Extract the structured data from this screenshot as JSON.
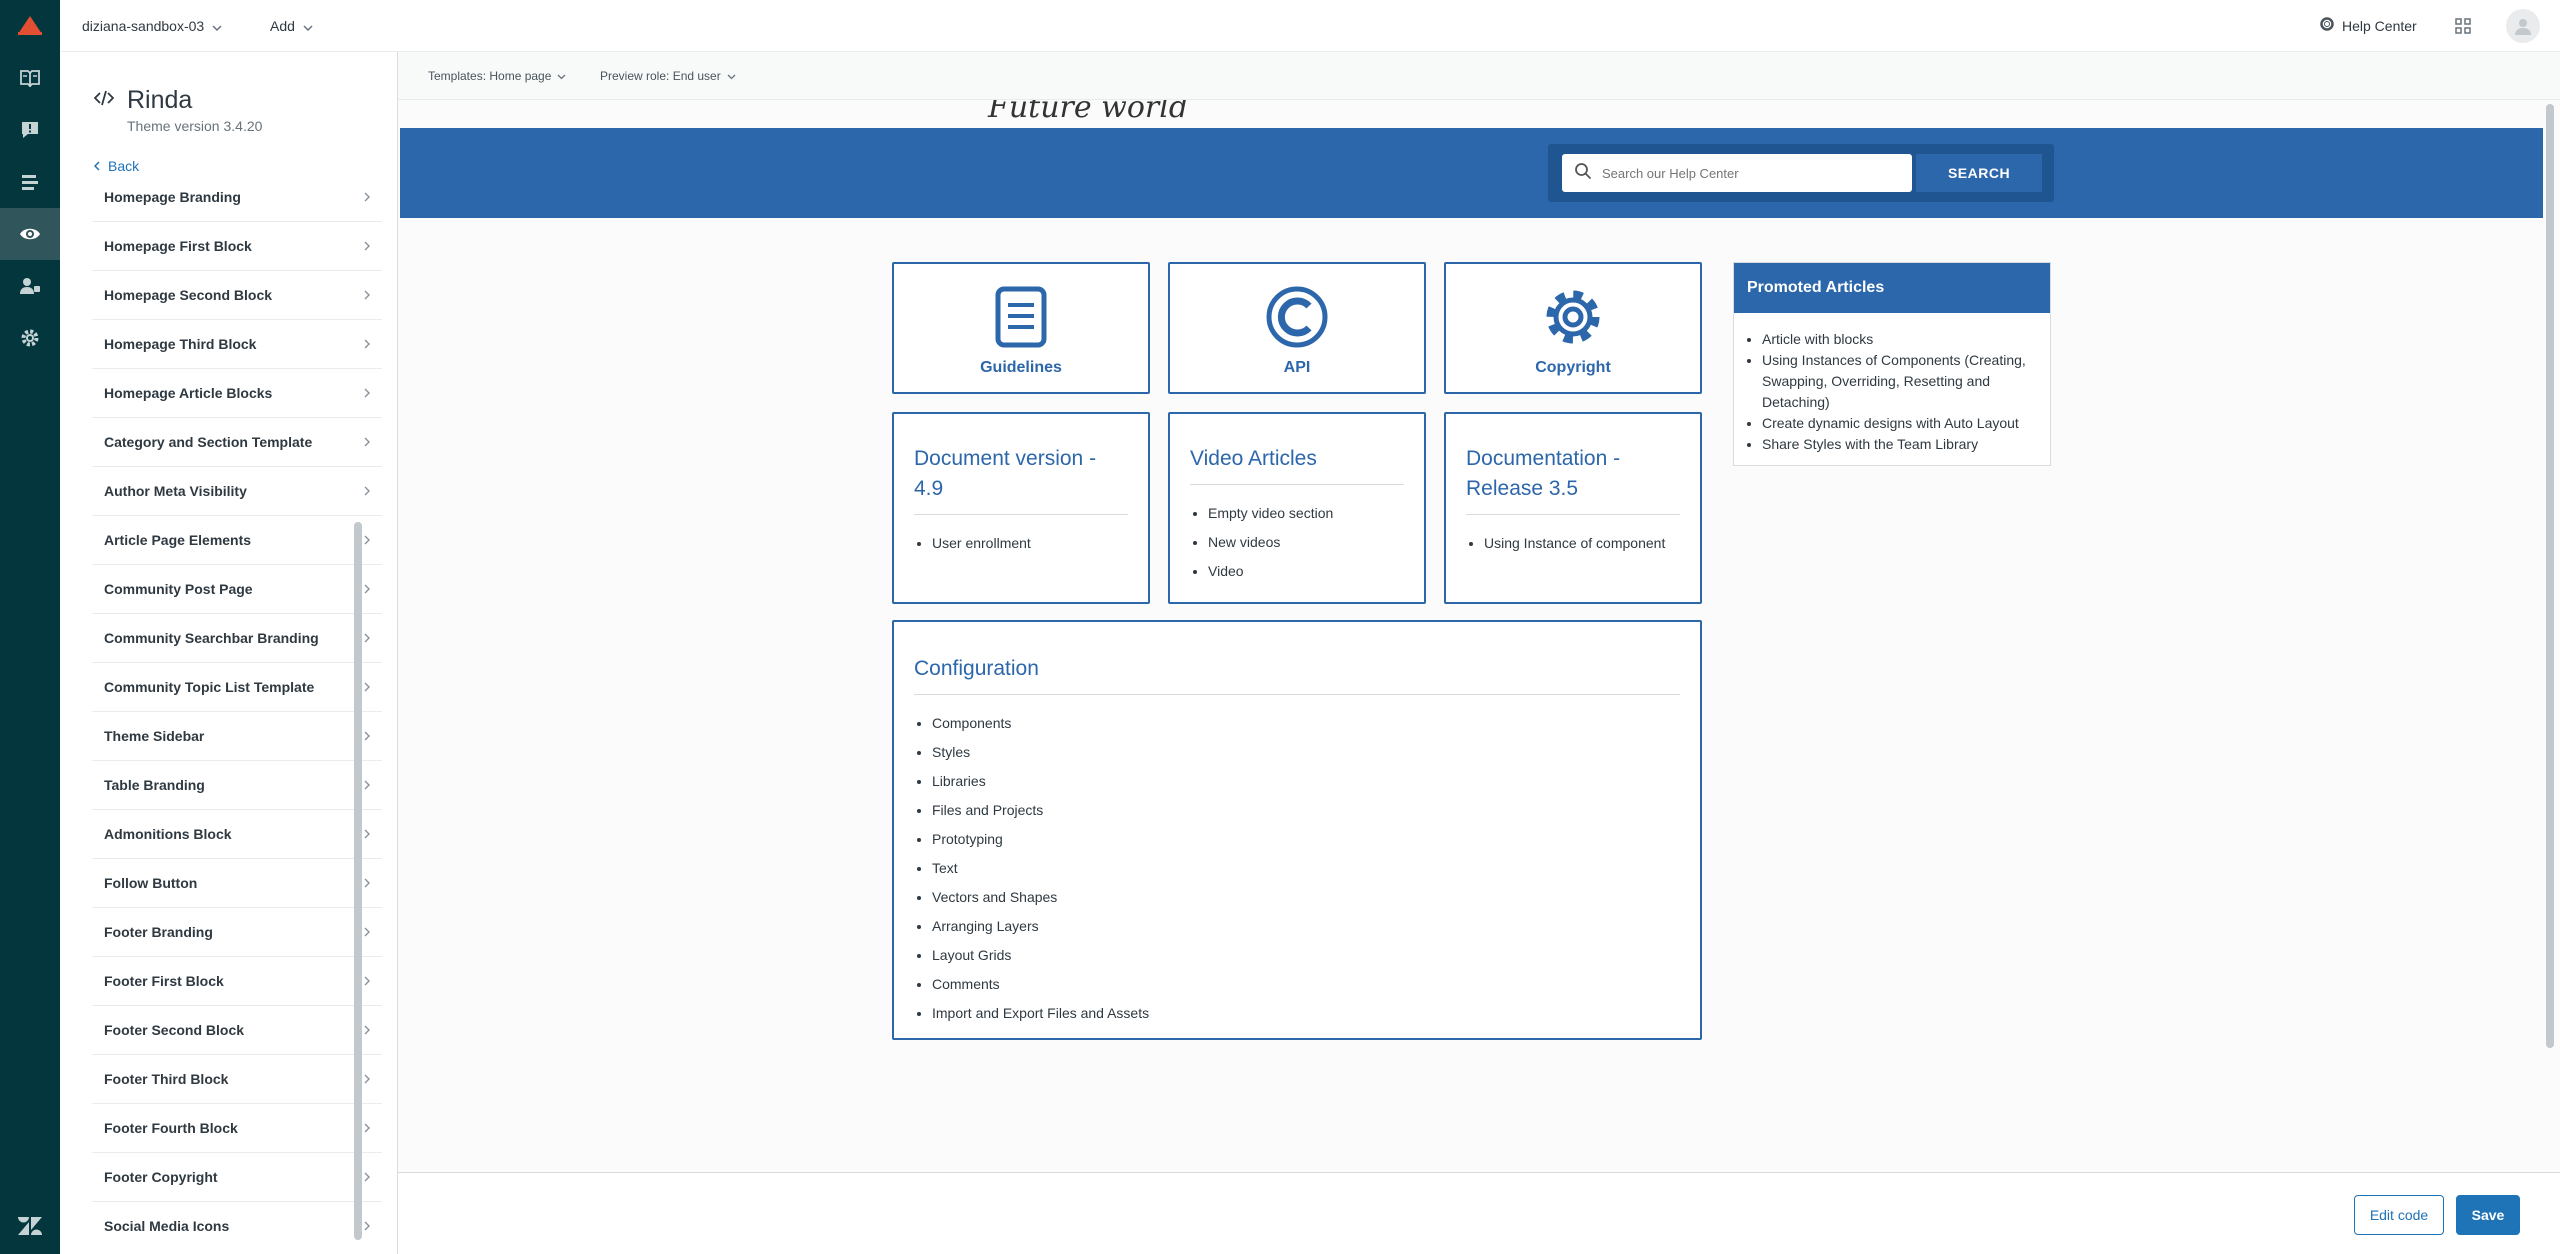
{
  "header": {
    "account": "diziana-sandbox-03",
    "add_label": "Add",
    "help_center": "Help Center"
  },
  "nav": {
    "icons": [
      "guide-icon",
      "feedback-icon",
      "arrange-icon",
      "customize-design-icon",
      "user-permissions-icon",
      "settings-icon"
    ],
    "active_index": 3
  },
  "panel": {
    "theme_name": "Rinda",
    "theme_version": "Theme version 3.4.20",
    "back_label": "Back",
    "items": [
      "Homepage Branding",
      "Homepage First Block",
      "Homepage Second Block",
      "Homepage Third Block",
      "Homepage Article Blocks",
      "Category and Section Template",
      "Author Meta Visibility",
      "Article Page Elements",
      "Community Post Page",
      "Community Searchbar Branding",
      "Community Topic List Template",
      "Theme Sidebar",
      "Table Branding",
      "Admonitions Block",
      "Follow Button",
      "Footer Branding",
      "Footer First Block",
      "Footer Second Block",
      "Footer Third Block",
      "Footer Fourth Block",
      "Footer Copyright",
      "Social Media Icons"
    ]
  },
  "preview": {
    "template_label": "Templates: Home page",
    "role_label": "Preview role: End user",
    "site_logo_text": "Future world",
    "search_placeholder": "Search our Help Center",
    "search_button": "SEARCH",
    "icon_cards": [
      {
        "label": "Guidelines",
        "icon": "document-icon"
      },
      {
        "label": "API",
        "icon": "copyright-circle-icon"
      },
      {
        "label": "Copyright",
        "icon": "gear-icon"
      }
    ],
    "sections": [
      {
        "title": "Document version - 4.9",
        "items": [
          "User enrollment"
        ]
      },
      {
        "title": "Video Articles",
        "items": [
          "Empty video section",
          "New videos",
          "Video"
        ]
      },
      {
        "title": "Documentation - Release 3.5",
        "items": [
          "Using Instance of component"
        ]
      }
    ],
    "configuration": {
      "title": "Configuration",
      "items": [
        "Components",
        "Styles",
        "Libraries",
        "Files and Projects",
        "Prototyping",
        "Text",
        "Vectors and Shapes",
        "Arranging Layers",
        "Layout Grids",
        "Comments",
        "Import and Export Files and Assets"
      ]
    },
    "promoted": {
      "title": "Promoted Articles",
      "items": [
        "Article with blocks",
        "Using Instances of Components (Creating, Swapping, Overriding, Resetting and Detaching)",
        "Create dynamic designs with Auto Layout",
        "Share Styles with the Team Library"
      ]
    }
  },
  "footer": {
    "edit_code": "Edit code",
    "save": "Save"
  },
  "colors": {
    "nav_bg": "#03363d",
    "brand_blue": "#2c66ab",
    "action_blue": "#1f73b7"
  }
}
